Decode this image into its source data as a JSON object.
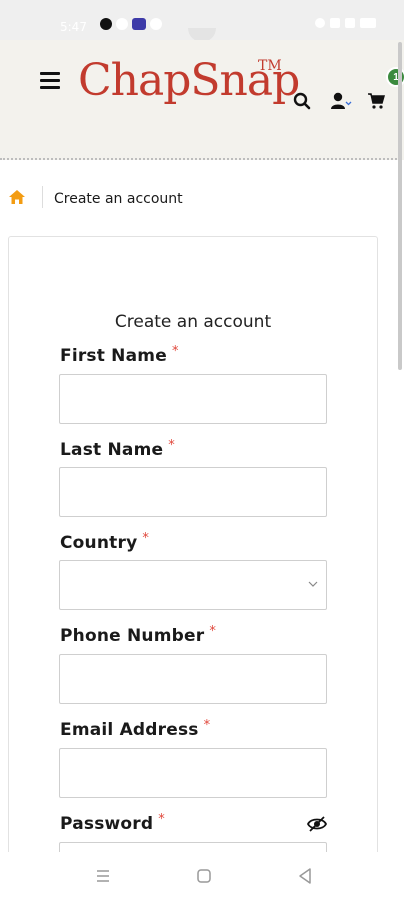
{
  "status_bar": {
    "time": "5:47",
    "icons": [
      "google-icon",
      "notification-icon",
      "settings-icon",
      "app-icon",
      "sync-icon",
      "alarm-icon",
      "wifi-icon",
      "signal-icon",
      "battery-icon"
    ]
  },
  "header": {
    "logo_text": "ChapSnap",
    "trademark": "TM",
    "cart_count": "1",
    "icons": [
      "menu-icon",
      "search-icon",
      "account-icon",
      "cart-icon"
    ],
    "brand_color": "#c23b2e",
    "badge_color": "#3b8a3e"
  },
  "breadcrumb": {
    "home_icon": "home-icon",
    "current": "Create an account",
    "home_color": "#f39c12"
  },
  "form": {
    "title": "Create an account",
    "required_mark": "*",
    "fields": {
      "first_name": {
        "label": "First Name",
        "value": ""
      },
      "last_name": {
        "label": "Last Name",
        "value": ""
      },
      "country": {
        "label": "Country",
        "value": ""
      },
      "phone": {
        "label": "Phone Number",
        "value": ""
      },
      "email": {
        "label": "Email Address",
        "value": ""
      },
      "password": {
        "label": "Password",
        "value": ""
      }
    },
    "required_color": "#e0463a"
  },
  "nav_bar": {
    "icons": [
      "recent-apps-icon",
      "home-button-icon",
      "back-icon"
    ]
  }
}
